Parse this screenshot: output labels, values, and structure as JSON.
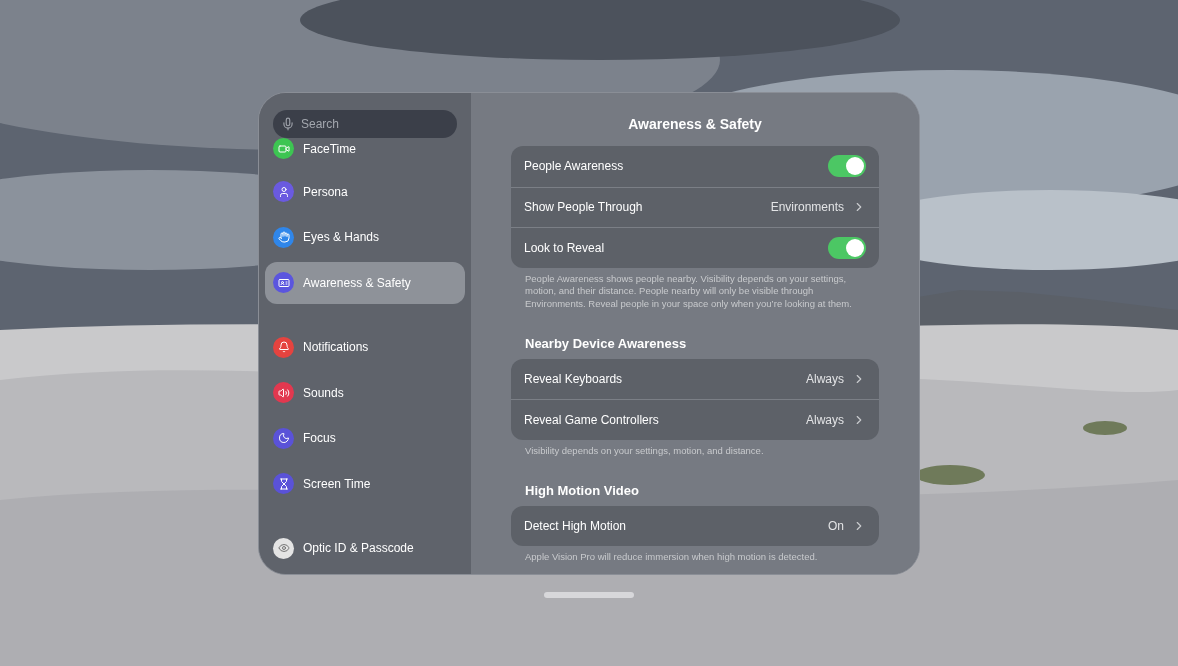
{
  "sidebar": {
    "search": {
      "placeholder": "Search"
    },
    "sections": [
      {
        "items": [
          {
            "label": "FaceTime",
            "color": "#3dc552",
            "selected": false
          },
          {
            "label": "Persona",
            "color": "#6a5ae0",
            "selected": false
          },
          {
            "label": "Eyes & Hands",
            "color": "#2f86ea",
            "selected": false
          },
          {
            "label": "Awareness & Safety",
            "color": "#5b55de",
            "selected": true
          }
        ]
      },
      {
        "items": [
          {
            "label": "Notifications",
            "color": "#e5433f",
            "selected": false
          },
          {
            "label": "Sounds",
            "color": "#e2384f",
            "selected": false
          },
          {
            "label": "Focus",
            "color": "#5a52d8",
            "selected": false
          },
          {
            "label": "Screen Time",
            "color": "#5a52d8",
            "selected": false
          }
        ]
      },
      {
        "items": [
          {
            "label": "Optic ID & Passcode",
            "color": "#e4e4e4",
            "selected": false
          }
        ]
      }
    ]
  },
  "detail": {
    "title": "Awareness & Safety",
    "groups": [
      {
        "rows": [
          {
            "kind": "toggle",
            "label": "People Awareness",
            "on": true
          },
          {
            "kind": "link",
            "label": "Show People Through",
            "value": "Environments"
          },
          {
            "kind": "toggle",
            "label": "Look to Reveal",
            "on": true
          }
        ],
        "footer": "People Awareness shows people nearby. Visibility depends on your settings, motion, and their distance. People nearby will only be visible through Environments. Reveal people in your space only when you’re looking at them."
      },
      {
        "header": "Nearby Device Awareness",
        "rows": [
          {
            "kind": "link",
            "label": "Reveal Keyboards",
            "value": "Always"
          },
          {
            "kind": "link",
            "label": "Reveal Game Controllers",
            "value": "Always"
          }
        ],
        "footer": "Visibility depends on your settings, motion, and distance."
      },
      {
        "header": "High Motion Video",
        "rows": [
          {
            "kind": "link",
            "label": "Detect High Motion",
            "value": "On"
          }
        ],
        "footer": "Apple Vision Pro will reduce immersion when high motion is detected."
      }
    ]
  }
}
